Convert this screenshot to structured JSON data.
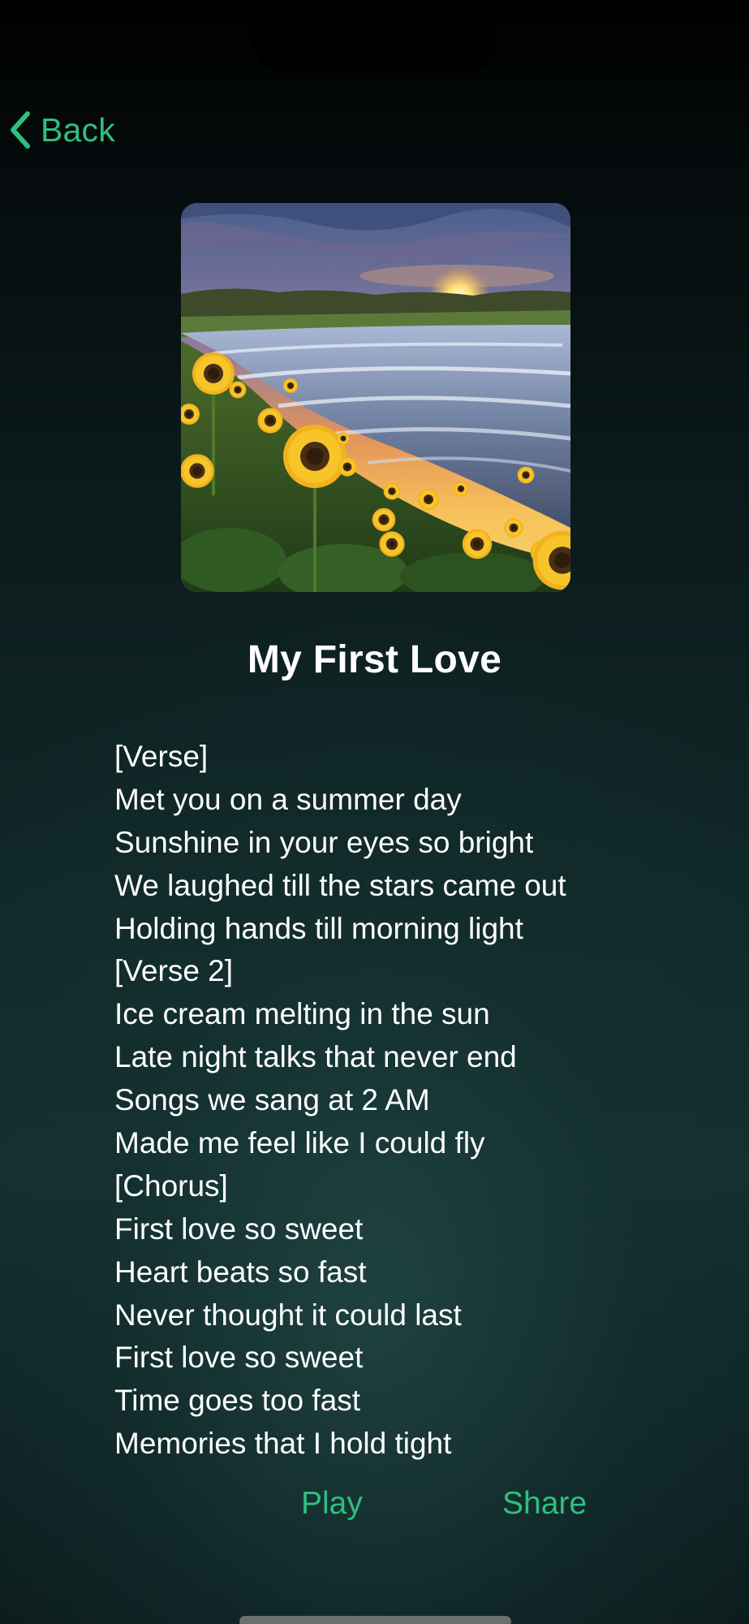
{
  "nav": {
    "back_label": "Back",
    "back_icon": "chevron-left-icon"
  },
  "song": {
    "title": "My First Love",
    "artwork_description_icon": "album-artwork-image"
  },
  "lyrics": [
    "[Verse]",
    "Met you on a summer day",
    "Sunshine in your eyes so bright",
    "We laughed till the stars came out",
    "Holding hands till morning light",
    "[Verse 2]",
    "Ice cream melting in the sun",
    "Late night talks that never end",
    "Songs we sang at 2 AM",
    "Made me feel like I could fly",
    "[Chorus]",
    "First love so sweet",
    "Heart beats so fast",
    "Never thought it could last",
    "First love so sweet",
    "Time goes too fast",
    "Memories that I hold tight"
  ],
  "actions": {
    "play_label": "Play",
    "share_label": "Share"
  },
  "colors": {
    "accent": "#2fbf7f",
    "text": "#ffffff",
    "background_top": "#000000",
    "background_bottom": "#143030"
  }
}
